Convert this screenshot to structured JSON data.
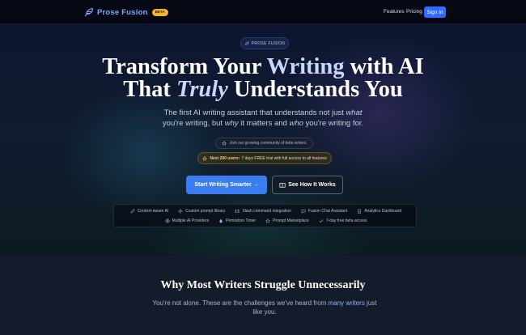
{
  "nav": {
    "brand": "Prose Fusion",
    "badge": "BETA",
    "links": [
      "Features",
      "Pricing"
    ],
    "signin": "Sign In"
  },
  "hero": {
    "pill": "PROSE FUSION",
    "headline": {
      "line1a": "Transform Your ",
      "line1b": "Writing",
      "line1c": " with AI",
      "line2a": "That ",
      "line2b": "Truly",
      "line2c": " Understands You"
    },
    "sub": {
      "p1": "The first AI writing assistant that understands not just ",
      "what": "what",
      "p2": " you're writing, but ",
      "why": "why",
      "p3": " it matters and ",
      "who": "who",
      "p4": " you're writing for."
    },
    "community": "Join our growing community of beta writers",
    "offer_bold": "Next 200 users:",
    "offer_rest": " 7 days FREE trial with full access to all features",
    "cta_primary": "Start Writing Smarter →",
    "cta_secondary": "See How It Works",
    "features_row1": [
      {
        "icon": "pen-icon",
        "label": "Context-aware AI"
      },
      {
        "icon": "sparkle-icon",
        "label": "Custom prompt library"
      },
      {
        "icon": "command-icon",
        "label": "Slash command integration"
      },
      {
        "icon": "chat-icon",
        "label": "Fusion Chat Assistant"
      },
      {
        "icon": "document-icon",
        "label": "Analytics Dashboard"
      }
    ],
    "features_row2": [
      {
        "icon": "globe-icon",
        "label": "Multiple AI Providers"
      },
      {
        "icon": "drop-icon",
        "label": "Pomodoro Timer"
      },
      {
        "icon": "star-icon",
        "label": "Prompt Marketplace"
      },
      {
        "icon": "check-icon",
        "label": "7-day free beta access"
      }
    ]
  },
  "section2": {
    "title": "Why Most Writers Struggle Unnecessarily",
    "sub_a": "You're not alone. These are the challenges we've heard from ",
    "sub_hl": "many writers",
    "sub_b": " just like you."
  },
  "colors": {
    "accent": "#3b7cf0",
    "brand_text": "#7aa7ff",
    "badge": "#f2b632",
    "offer_text": "#f4d27a"
  }
}
